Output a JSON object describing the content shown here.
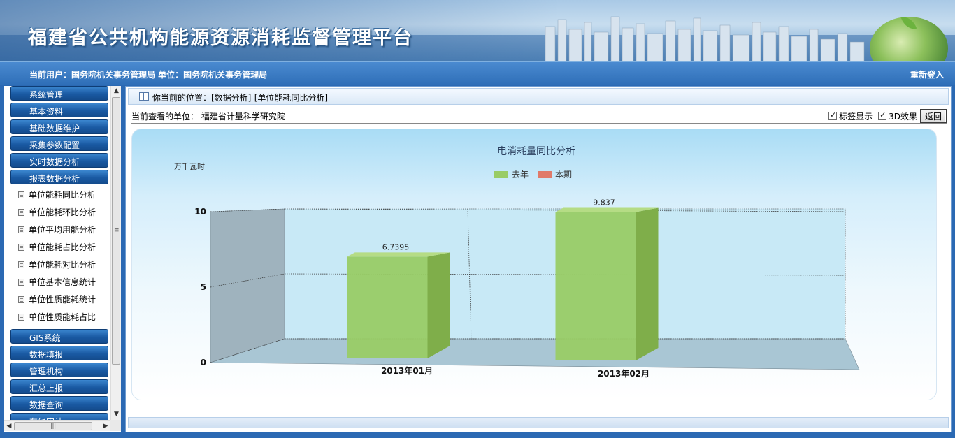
{
  "header": {
    "title": "福建省公共机构能源资源消耗监督管理平台",
    "user_info": "当前用户：国务院机关事务管理局  单位：国务院机关事务管理局",
    "relogin": "重新登入"
  },
  "sidebar": {
    "top_menus": [
      "系统管理",
      "基本资料",
      "基础数据维护",
      "采集参数配置",
      "实时数据分析",
      "报表数据分析"
    ],
    "sub_items": [
      "单位能耗同比分析",
      "单位能耗环比分析",
      "单位平均用能分析",
      "单位能耗占比分析",
      "单位能耗对比分析",
      "单位基本信息统计",
      "单位性质能耗统计",
      "单位性质能耗占比"
    ],
    "bottom_menus": [
      "GIS系统",
      "数据填报",
      "管理机构",
      "汇总上报",
      "数据查询",
      "在线审计"
    ]
  },
  "content": {
    "breadcrumb": "你当前的位置：[数据分析]-[单位能耗同比分析]",
    "unit_label": "当前查看的单位：  福建省计量科学研究院",
    "opt_label": "标签显示",
    "opt_3d": "3D效果",
    "back": "返回"
  },
  "chart_data": {
    "type": "bar",
    "title": "电消耗量同比分析",
    "ylabel": "万千瓦时",
    "categories": [
      "2013年01月",
      "2013年02月"
    ],
    "series": [
      {
        "name": "去年",
        "values": [
          6.7395,
          9.837
        ],
        "labels": [
          "6.7395",
          "9.837"
        ],
        "color": "#99cc66"
      },
      {
        "name": "本期",
        "values": [
          null,
          null
        ],
        "color": "#e07a6a"
      }
    ],
    "ylim": [
      0,
      10
    ],
    "yticks": [
      "0",
      "5",
      "10"
    ],
    "legend": "top-center",
    "grid": true,
    "three_d": true
  },
  "colors": {
    "brand_blue": "#2b69b3",
    "menu_blue": "#1a5aa3"
  },
  "icons": {
    "breadcrumb": "book-icon",
    "sub_item": "document-icon"
  }
}
